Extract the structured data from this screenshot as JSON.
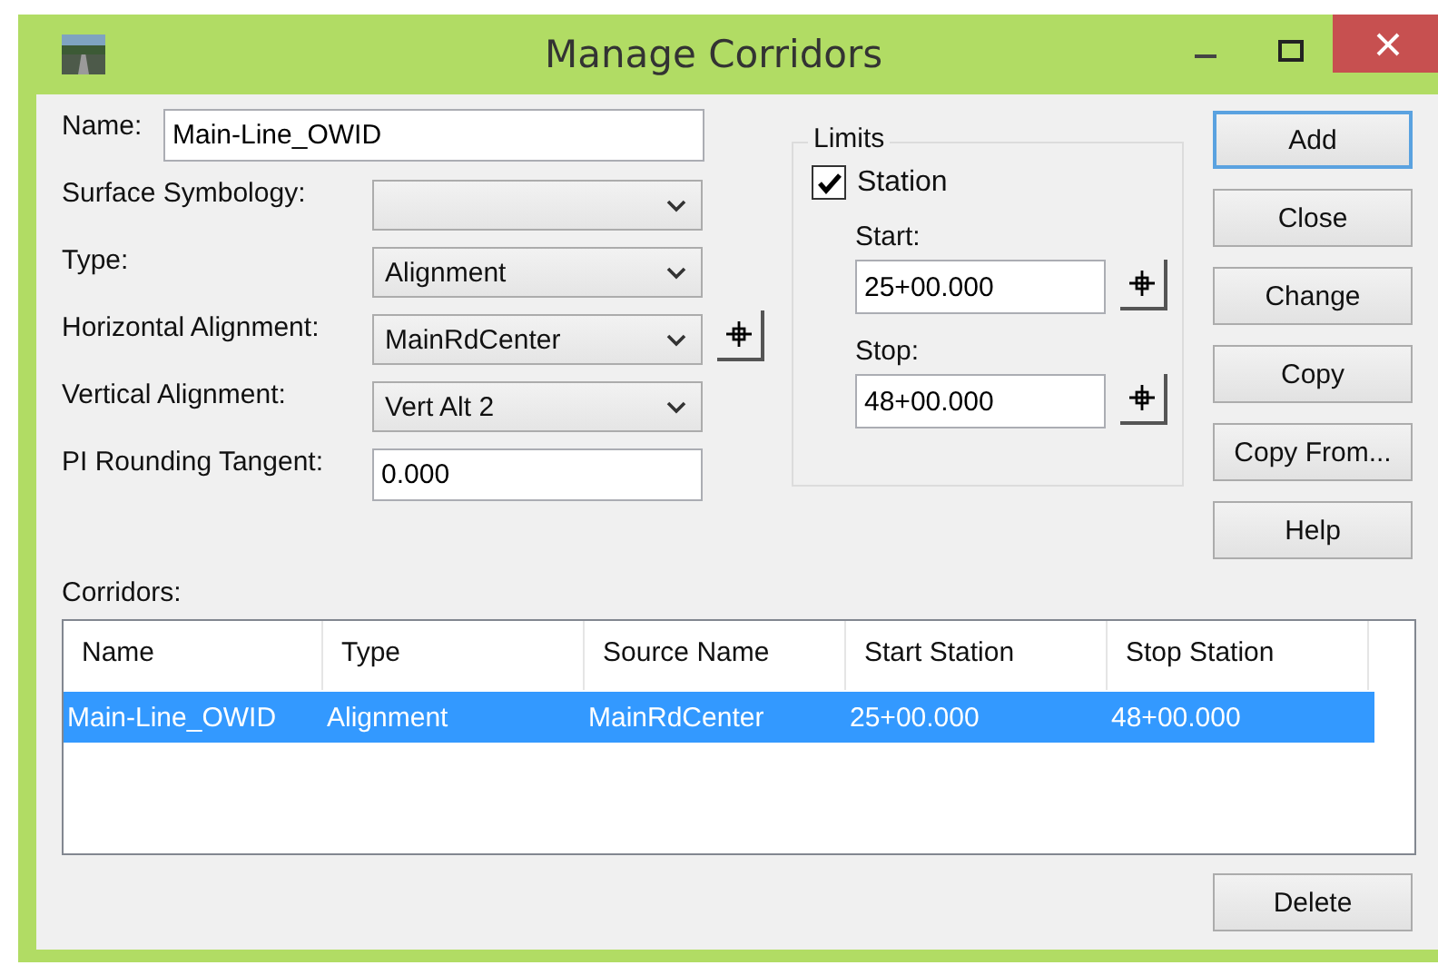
{
  "window": {
    "title": "Manage Corridors"
  },
  "form": [
    {
      "label": "Name:",
      "kind": "text",
      "value": "Main-Line_OWID"
    },
    {
      "label": "Surface Symbology:",
      "kind": "dropdown"
    },
    {
      "label": "Type:",
      "kind": "dropdown",
      "value": "Alignment"
    },
    {
      "label": "Horizontal Alignment:",
      "kind": "dropdown",
      "value": "MainRdCenter",
      "picker": true
    },
    {
      "label": "Vertical Alignment:",
      "kind": "dropdown",
      "value": "Vert Alt 2"
    },
    {
      "label": "PI Rounding Tangent:",
      "kind": "number",
      "value": "0.000"
    }
  ],
  "limits": {
    "title": "Limits",
    "station": {
      "label": "Station",
      "checked": true
    },
    "start": {
      "label": "Start:",
      "value": "25+00.000"
    },
    "stop": {
      "label": "Stop:",
      "value": "48+00.000"
    }
  },
  "buttons": [
    {
      "label": "Add",
      "default": true
    },
    {
      "label": "Close",
      "default": false
    },
    {
      "label": "Change",
      "default": false
    },
    {
      "label": "Copy",
      "default": false
    },
    {
      "label": "Copy From...",
      "default": false
    },
    {
      "label": "Help",
      "default": false
    }
  ],
  "corridors": {
    "label": "Corridors:",
    "columns": [
      "Name",
      "Type",
      "Source Name",
      "Start Station",
      "Stop Station"
    ],
    "rows": [
      {
        "cells": [
          "Main-Line_OWID",
          "Alignment",
          "MainRdCenter",
          "25+00.000",
          "48+00.000"
        ],
        "selected": true
      }
    ]
  },
  "delete_button": {
    "label": "Delete"
  }
}
